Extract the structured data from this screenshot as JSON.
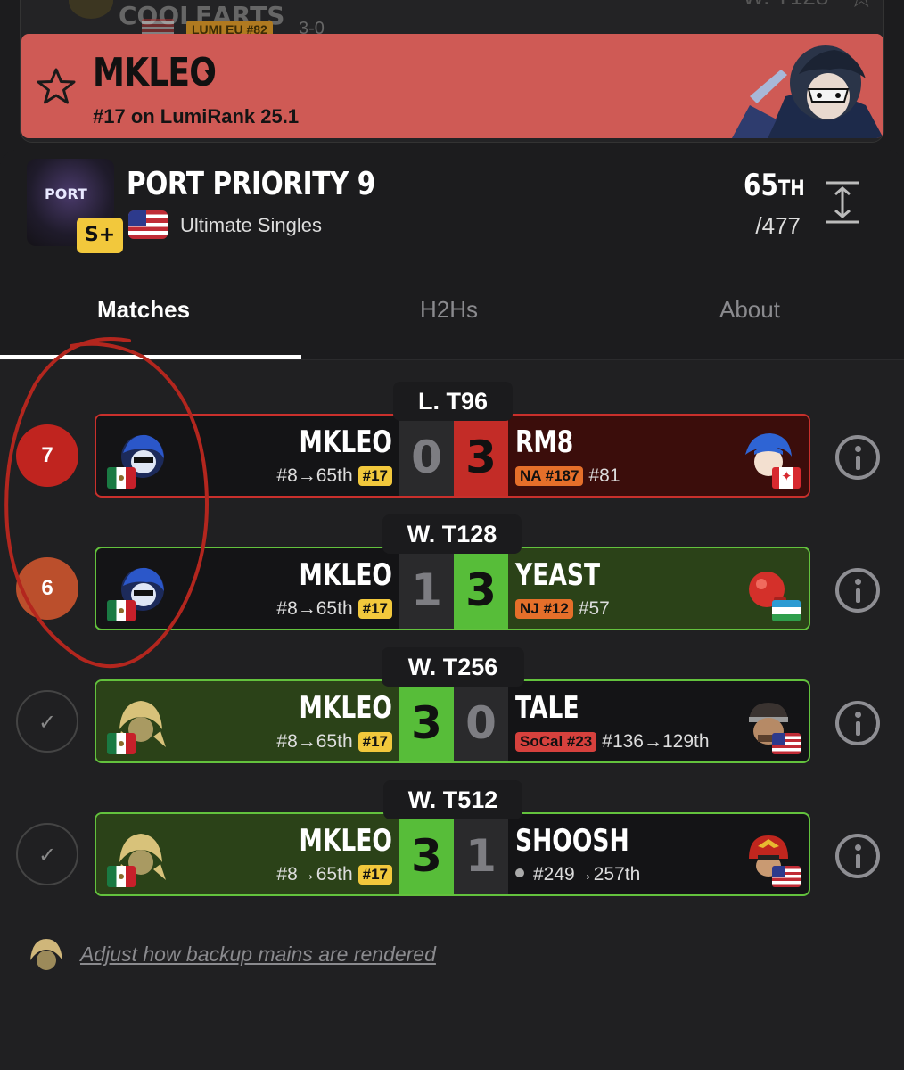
{
  "background_card": {
    "name": "COOLEARTS",
    "badge": "LUMI EU #82",
    "record": "3-0",
    "round": "W. T128"
  },
  "banner": {
    "player_name": "MKLEO",
    "rank_line": "#17 on LumiRank 25.1"
  },
  "tournament": {
    "logo_text": "PORT",
    "tier": "S+",
    "name": "PORT PRIORITY 9",
    "event": "Ultimate Singles",
    "placing": "65",
    "placing_suffix": "TH",
    "entrants": "/477"
  },
  "tabs": [
    {
      "label": "Matches",
      "active": true
    },
    {
      "label": "H2Hs",
      "active": false
    },
    {
      "label": "About",
      "active": false
    }
  ],
  "matches": [
    {
      "round": "L. T96",
      "status": "7",
      "p1": {
        "name": "MKLEO",
        "sub": "#8→65th",
        "tag": "#17"
      },
      "score1": "0",
      "score2": "3",
      "p2": {
        "name": "RM8",
        "tag": "NA #187",
        "sub": "#81"
      }
    },
    {
      "round": "W. T128",
      "status": "6",
      "p1": {
        "name": "MKLEO",
        "sub": "#8→65th",
        "tag": "#17"
      },
      "score1": "1",
      "score2": "3",
      "p2": {
        "name": "YEAST",
        "tag": "NJ #12",
        "sub": "#57"
      }
    },
    {
      "round": "W. T256",
      "status": "✓",
      "p1": {
        "name": "MKLEO",
        "sub": "#8→65th",
        "tag": "#17"
      },
      "score1": "3",
      "score2": "0",
      "p2": {
        "name": "TALE",
        "tag": "SoCal #23",
        "sub": "#136→129th"
      }
    },
    {
      "round": "W. T512",
      "status": "✓",
      "p1": {
        "name": "MKLEO",
        "sub": "#8→65th",
        "tag": "#17"
      },
      "score1": "3",
      "score2": "1",
      "p2": {
        "name": "SHOOSH",
        "tag": "",
        "sub": "#249→257th"
      }
    }
  ],
  "footer": {
    "backup_link": "Adjust how backup mains are rendered"
  },
  "colors": {
    "banner": "#cf5a55",
    "win": "#57bd39",
    "lose": "#c32c27",
    "tier": "#f2c83c",
    "annotation": "#b3261e"
  }
}
